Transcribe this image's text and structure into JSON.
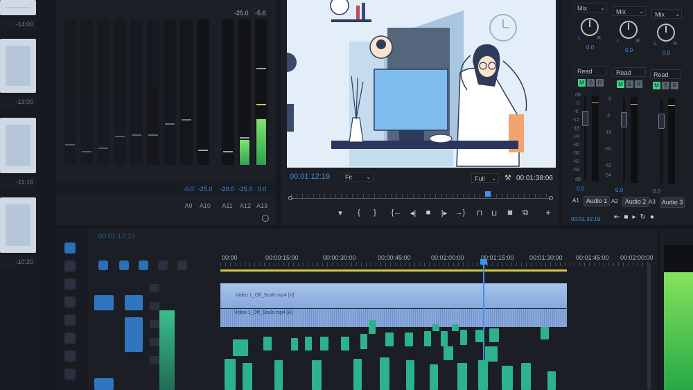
{
  "project_panel": {
    "thumb_labels": [
      "-14:00",
      "-13:00",
      "-11:16",
      "-10:20"
    ]
  },
  "audio_meters": {
    "top_values": [
      "-25.0",
      "-5.6"
    ],
    "values": [
      "-0.0",
      "-25.0",
      "-20.0",
      "-25.0",
      "0.0"
    ],
    "channels": [
      "A9",
      "A10",
      "A11",
      "A12",
      "A13"
    ]
  },
  "program_monitor": {
    "current_timecode": "00:01:12:19",
    "fit_label": "Fit",
    "quality_label": "Full",
    "duration_timecode": "00:01:38:06",
    "controls": [
      {
        "name": "add-marker-icon",
        "glyph": "▾"
      },
      {
        "name": "mark-in-icon",
        "glyph": "{"
      },
      {
        "name": "mark-out-icon",
        "glyph": "}"
      },
      {
        "name": "go-to-in-icon",
        "glyph": "{←"
      },
      {
        "name": "step-back-icon",
        "glyph": "◂|"
      },
      {
        "name": "stop-icon",
        "glyph": "■"
      },
      {
        "name": "step-forward-icon",
        "glyph": "|▸"
      },
      {
        "name": "go-to-out-icon",
        "glyph": "→}"
      },
      {
        "name": "lift-icon",
        "glyph": "⊓"
      },
      {
        "name": "extract-icon",
        "glyph": "⊔"
      },
      {
        "name": "camera-icon",
        "glyph": "◙"
      },
      {
        "name": "compare-icon",
        "glyph": "⧉"
      },
      {
        "name": "add-button-icon",
        "glyph": "+"
      }
    ]
  },
  "audio_mixer": {
    "channels": [
      {
        "mix_label": "Mix",
        "pan_value": "0.0",
        "automation": "Read",
        "meter_value": "0.0",
        "track": "A1",
        "name": "Audio 1"
      },
      {
        "mix_label": "Mix",
        "pan_value": "0.0",
        "automation": "Read",
        "meter_value": "0.0",
        "track": "A2",
        "name": "Audio 2"
      },
      {
        "mix_label": "Mix",
        "pan_value": "0.0",
        "automation": "Read",
        "meter_value": "0.0",
        "track": "A3",
        "name": "Audio 3"
      }
    ],
    "db_ticks": [
      "dB",
      "6",
      "0",
      "-6",
      "-12",
      "-18",
      "-24",
      "-30",
      "-36",
      "-42",
      "-48",
      "-54",
      "dB"
    ],
    "left_label": "L",
    "right_label": "R",
    "msr": [
      "M",
      "S",
      "R"
    ],
    "timecode": "00:01:32:19"
  },
  "timeline": {
    "sequence_timecode": "00:01:12:19",
    "ruler": [
      "00:00",
      "00:00:15:00",
      "00:00:30:00",
      "00:00:45:00",
      "00:01:00:00",
      "00:01:15:00",
      "00:01:30:00",
      "00:01:45:00",
      "00:02:00:00"
    ],
    "video_clip_name": "Video 1_Off_Scale.mp4 [V]",
    "audio_clip_name": "Video 1_Off_Scale.mp4 [A]"
  },
  "colors": {
    "accent_blue": "#3e93ea",
    "meter_green": "#3ecf5a",
    "clip_teal": "#2db28f",
    "clip_blue": "#9ab7e3",
    "work_area_yellow": "#d8c93e"
  }
}
